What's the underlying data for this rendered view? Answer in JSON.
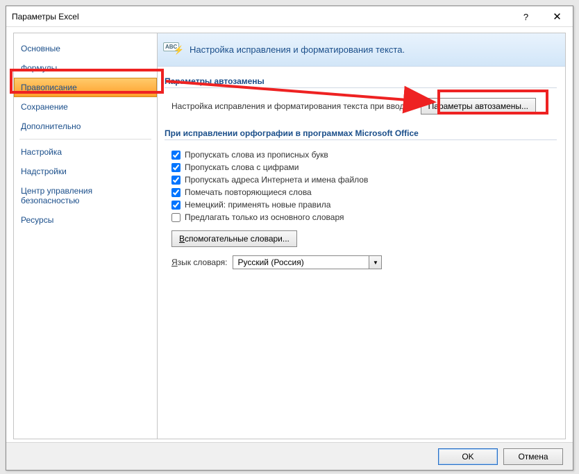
{
  "titlebar": {
    "title": "Параметры Excel",
    "help": "?",
    "close": "✕"
  },
  "sidebar": {
    "items": [
      {
        "label": "Основные"
      },
      {
        "label": "Формулы"
      },
      {
        "label": "Правописание",
        "selected": true
      },
      {
        "label": "Сохранение"
      },
      {
        "label": "Дополнительно"
      }
    ],
    "items2": [
      {
        "label": "Настройка"
      },
      {
        "label": "Надстройки"
      },
      {
        "label": "Центр управления безопасностью"
      },
      {
        "label": "Ресурсы"
      }
    ]
  },
  "header": {
    "icon_label": "ABC",
    "title": "Настройка исправления и форматирования текста."
  },
  "section1": {
    "title": "Параметры автозамены",
    "row_text": "Настройка исправления и форматирования текста при вводе:",
    "button": "Параметры автозамены..."
  },
  "section2": {
    "title": "При исправлении орфографии в программах Microsoft Office",
    "checks": [
      {
        "label": "Пропускать слова из прописных букв",
        "checked": true
      },
      {
        "label": "Пропускать слова с цифрами",
        "checked": true
      },
      {
        "label": "Пропускать адреса Интернета и имена файлов",
        "checked": true
      },
      {
        "label": "Помечать повторяющиеся слова",
        "checked": true
      },
      {
        "label": "Немецкий: применять новые правила",
        "checked": true
      },
      {
        "label": "Предлагать только из основного словаря",
        "checked": false
      }
    ],
    "dict_button": "Вспомогательные словари...",
    "lang_label": "Язык словаря:",
    "lang_value": "Русский (Россия)"
  },
  "footer": {
    "ok": "OK",
    "cancel": "Отмена"
  }
}
